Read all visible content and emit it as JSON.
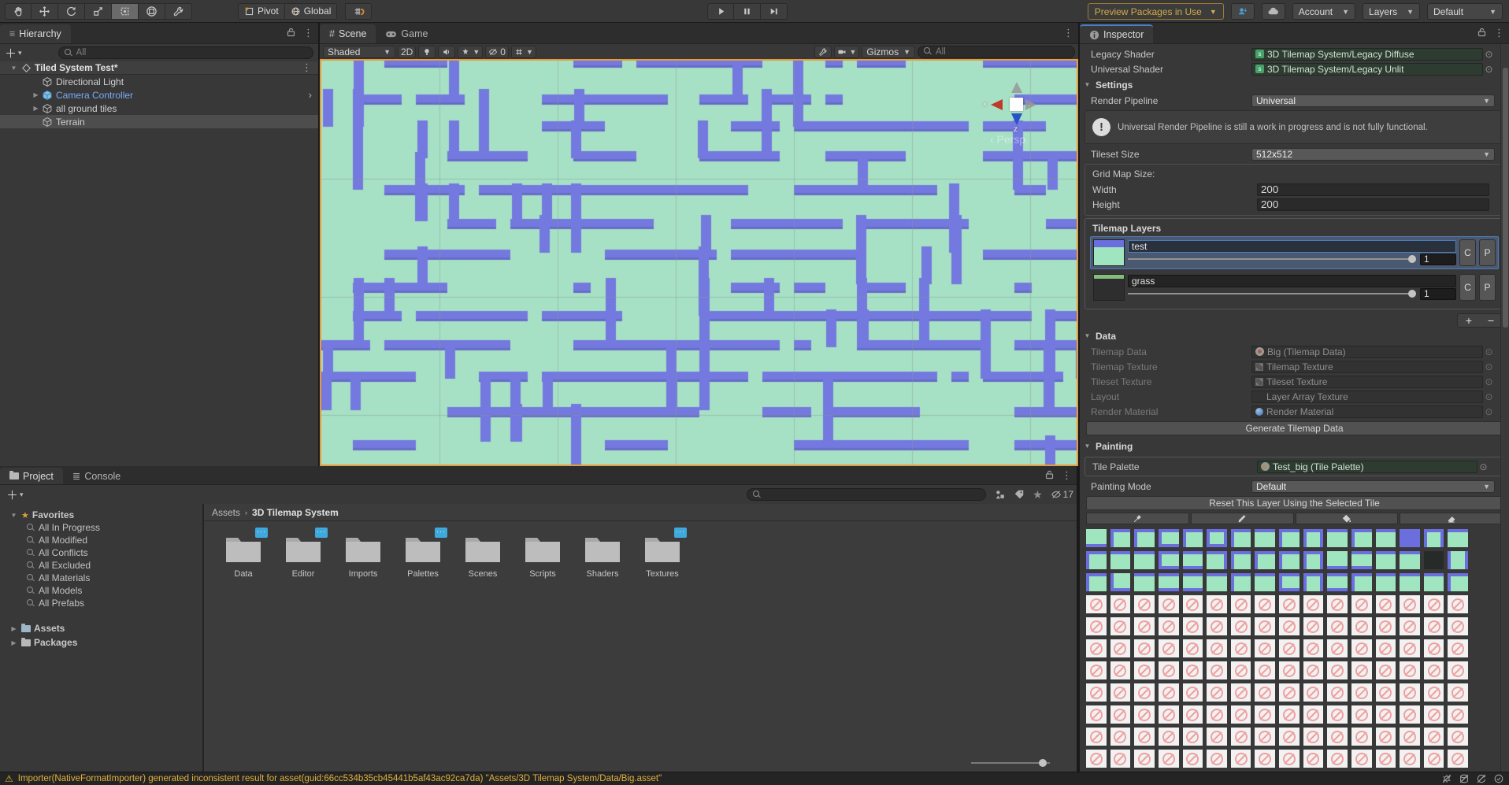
{
  "topbar": {
    "pivot_label": "Pivot",
    "global_label": "Global",
    "preview_packages_label": "Preview Packages in Use",
    "account_label": "Account",
    "layers_label": "Layers",
    "layout_label": "Default"
  },
  "hierarchy": {
    "tab_label": "Hierarchy",
    "search_placeholder": "All",
    "scene_name": "Tiled System Test*",
    "items": [
      {
        "label": "Directional Light",
        "expand": false,
        "prefab": false,
        "selected": false
      },
      {
        "label": "Camera Controller",
        "expand": true,
        "prefab": true,
        "selected": false,
        "more": "›"
      },
      {
        "label": "all ground tiles",
        "expand": true,
        "prefab": false,
        "selected": false
      },
      {
        "label": "Terrain",
        "expand": false,
        "prefab": false,
        "selected": true
      }
    ]
  },
  "scene": {
    "tabs": [
      "Scene",
      "Game"
    ],
    "shading": "Shaded",
    "d2_label": "2D",
    "hidden_count": "0",
    "gizmos_label": "Gizmos",
    "search_placeholder": "All",
    "axis": {
      "x": "x",
      "z": "z",
      "persp": "‹ Persp"
    },
    "maze": {
      "bg": "#a6e0c5",
      "path": "#7379de",
      "grid": "#8f9a94",
      "seed": 1337,
      "cell": 40,
      "thick": 13
    }
  },
  "inspector": {
    "tab_label": "Inspector",
    "rows": {
      "legacy_shader": {
        "label": "Legacy Shader",
        "value": "3D Tilemap System/Legacy Diffuse"
      },
      "universal_shader": {
        "label": "Universal Shader",
        "value": "3D Tilemap System/Legacy Unlit"
      },
      "settings_title": "Settings",
      "render_pipeline": {
        "label": "Render Pipeline",
        "value": "Universal"
      },
      "warning": "Universal Render Pipeline is still a work in progress and is not fully functional.",
      "tileset_size": {
        "label": "Tileset Size",
        "value": "512x512"
      },
      "grid_map": {
        "title": "Grid Map Size:",
        "width_label": "Width",
        "width": "200",
        "height_label": "Height",
        "height": "200"
      }
    },
    "layers": {
      "title": "Tilemap Layers",
      "copy": "C",
      "paste": "P",
      "add": "+",
      "remove": "−",
      "items": [
        {
          "name": "test",
          "opacity": "1",
          "selected": true,
          "thumb": "tiles"
        },
        {
          "name": "grass",
          "opacity": "1",
          "selected": false,
          "thumb": "grass"
        }
      ]
    },
    "data": {
      "title": "Data",
      "generate_button": "Generate Tilemap Data",
      "rows": [
        {
          "label": "Tilemap Data",
          "value": "Big (Tilemap Data)",
          "icon": "gear"
        },
        {
          "label": "Tilemap Texture",
          "value": "Tilemap Texture",
          "icon": "texture"
        },
        {
          "label": "Tileset Texture",
          "value": "Tileset Texture",
          "icon": "texture"
        },
        {
          "label": "Layout",
          "value": "Layer Array Texture",
          "icon": "none"
        },
        {
          "label": "Render Material",
          "value": "Render Material",
          "icon": "material"
        }
      ]
    },
    "painting": {
      "title": "Painting",
      "tile_palette": {
        "label": "Tile Palette",
        "value": "Test_big (Tile Palette)"
      },
      "painting_mode": {
        "label": "Painting Mode",
        "value": "Default"
      },
      "reset_button": "Reset This Layer Using the Selected Tile",
      "tools": [
        "eyedropper",
        "brush",
        "bucket",
        "eraser"
      ],
      "palette": {
        "columns": 16,
        "tile_rows": [
          [
            "b",
            "lt",
            "lt",
            "ltb",
            "lt",
            "ltrb",
            "lt",
            "t",
            "lt",
            "ltr",
            "t",
            "lt",
            "t",
            "solid",
            "ltr",
            "t"
          ],
          [
            "lt",
            "t",
            "t",
            "ltb",
            "tb",
            "tr",
            "lt",
            "lt",
            "lt",
            "ltr",
            "b",
            "tb",
            "t",
            "t",
            "dark",
            "lr"
          ],
          [
            "lt",
            "lb",
            "t",
            "tb",
            "tb",
            "t",
            "lt",
            "t",
            "ltb",
            "ltr",
            "tb",
            "lt",
            "t",
            "t",
            "t",
            "lt"
          ]
        ],
        "empty_rows": 9
      }
    }
  },
  "project": {
    "tabs": [
      "Project",
      "Console"
    ],
    "search_placeholder": "",
    "hidden_count": "17",
    "favorites_label": "Favorites",
    "favorites": [
      "All In Progress",
      "All Modified",
      "All Conflicts",
      "All Excluded",
      "All Materials",
      "All Models",
      "All Prefabs"
    ],
    "roots": [
      "Assets",
      "Packages"
    ],
    "breadcrumb": [
      "Assets",
      "3D Tilemap System"
    ],
    "folders": [
      {
        "name": "Data",
        "badge": true
      },
      {
        "name": "Editor",
        "badge": true
      },
      {
        "name": "Imports",
        "badge": false
      },
      {
        "name": "Palettes",
        "badge": true
      },
      {
        "name": "Scenes",
        "badge": false
      },
      {
        "name": "Scripts",
        "badge": false
      },
      {
        "name": "Shaders",
        "badge": false
      },
      {
        "name": "Textures",
        "badge": true
      }
    ]
  },
  "status": {
    "message": "Importer(NativeFormatImporter) generated inconsistent result for asset(guid:66cc534b35cb45441b5af43ac92ca7da) \"Assets/3D Tilemap System/Data/Big.asset\""
  },
  "colors": {
    "selection_orange": "#e79b3b",
    "warning_text": "#e2b13d",
    "prefab_blue": "#7baaf7",
    "badge_blue": "#3fa9dc",
    "tile_teal": "#9fe5c0",
    "tile_purple": "#6b6fde"
  }
}
